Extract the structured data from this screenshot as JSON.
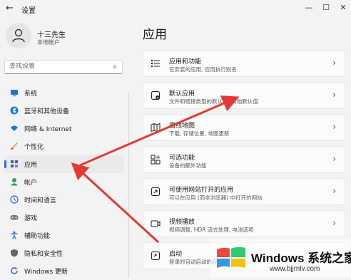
{
  "window": {
    "title": "设置",
    "back_icon": "back-arrow-icon",
    "min_icon": "—",
    "max_icon": "☐",
    "close_icon": "✕"
  },
  "profile": {
    "name": "十三先生",
    "account": "本地帐户"
  },
  "search": {
    "placeholder": "查找设置"
  },
  "sidebar": {
    "items": [
      {
        "label": "系统",
        "icon": "monitor-icon",
        "color": "#2b6cd9"
      },
      {
        "label": "蓝牙和其他设备",
        "icon": "bluetooth-icon",
        "color": "#1a73d9"
      },
      {
        "label": "网络 & Internet",
        "icon": "wifi-icon",
        "color": "#1a73d9"
      },
      {
        "label": "个性化",
        "icon": "brush-icon",
        "color": "#e6932e"
      },
      {
        "label": "应用",
        "icon": "apps-icon",
        "color": "#3a5ea8",
        "active": true
      },
      {
        "label": "帐户",
        "icon": "person-icon",
        "color": "#2aa35a"
      },
      {
        "label": "时间和语言",
        "icon": "globe-clock-icon",
        "color": "#2b6cd9"
      },
      {
        "label": "游戏",
        "icon": "gamepad-icon",
        "color": "#777777"
      },
      {
        "label": "辅助功能",
        "icon": "accessibility-icon",
        "color": "#2b6cd9"
      },
      {
        "label": "隐私和安全性",
        "icon": "shield-icon",
        "color": "#666666"
      },
      {
        "label": "Windows 更新",
        "icon": "update-icon",
        "color": "#2b6cd9"
      }
    ]
  },
  "main": {
    "title": "应用",
    "cards": [
      {
        "title": "应用和功能",
        "desc": "已安装的应用, 应用执行别名",
        "icon": "apps-list-icon"
      },
      {
        "title": "默认应用",
        "desc": "文件和链接类型的默认值, 其他默认值",
        "icon": "default-apps-icon"
      },
      {
        "title": "离线地图",
        "desc": "下载, 存储位置, 地图更新",
        "icon": "map-icon"
      },
      {
        "title": "可选功能",
        "desc": "设备的额外功能",
        "icon": "optional-features-icon"
      },
      {
        "title": "可使用网站打开的应用",
        "desc": "可以在应用 (而非浏览器) 中打开的网站",
        "icon": "website-apps-icon"
      },
      {
        "title": "视频播放",
        "desc": "视频调整, HDR 流式处理, 电池选项",
        "icon": "video-icon"
      },
      {
        "title": "启动",
        "desc": "登录时自动启动的应用",
        "icon": "startup-icon"
      }
    ]
  },
  "watermark": {
    "text": "Windows 系统之家",
    "url": "www.bjjmlv.com"
  },
  "annotation_color": "#e53935"
}
